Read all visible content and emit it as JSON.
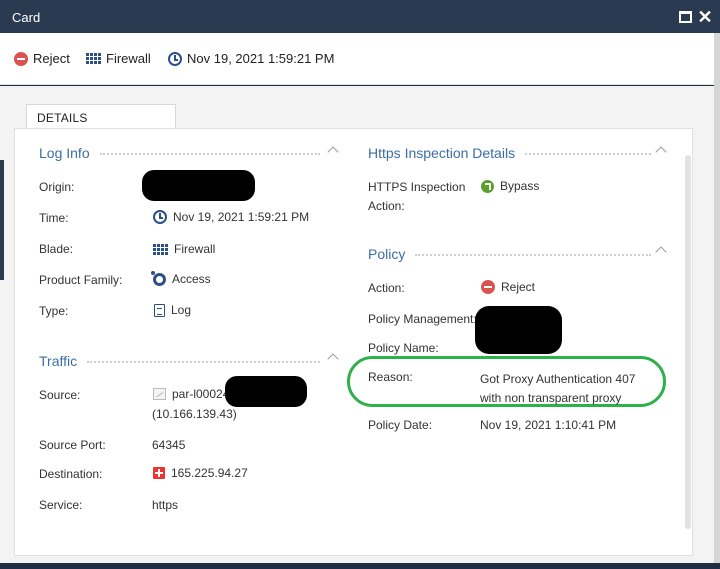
{
  "window": {
    "title": "Card"
  },
  "toolbar": {
    "action": "Reject",
    "blade": "Firewall",
    "time": "Nov 19, 2021 1:59:21 PM"
  },
  "tabs": [
    {
      "label": "DETAILS"
    }
  ],
  "log_info": {
    "title": "Log Info",
    "labels": {
      "origin": "Origin:",
      "time": "Time:",
      "blade": "Blade:",
      "product_family": "Product Family:",
      "type": "Type:"
    },
    "values": {
      "time": "Nov 19, 2021 1:59:21 PM",
      "blade": "Firewall",
      "product_family": "Access",
      "type": "Log"
    }
  },
  "traffic": {
    "title": "Traffic",
    "labels": {
      "source": "Source:",
      "source_port": "Source Port:",
      "destination": "Destination:",
      "service": "Service:"
    },
    "values": {
      "source_host": "par-l00024",
      "source_ip": "(10.166.139.43)",
      "source_port": "64345",
      "destination": "165.225.94.27",
      "service": "https"
    }
  },
  "https_inspection": {
    "title": "Https Inspection Details",
    "labels": {
      "action_line1": "HTTPS Inspection",
      "action_line2": "Action:"
    },
    "values": {
      "action": "Bypass"
    }
  },
  "policy": {
    "title": "Policy",
    "labels": {
      "action": "Action:",
      "management": "Policy Management:",
      "name": "Policy Name:",
      "reason": "Reason:",
      "date": "Policy Date:"
    },
    "values": {
      "action": "Reject",
      "reason": "Got Proxy Authentication 407 with non transparent proxy",
      "date": "Nov 19, 2021 1:10:41 PM"
    }
  },
  "colors": {
    "accent": "#3a6ea5",
    "titlebar": "#2a3a50",
    "reject": "#d9534f",
    "bypass": "#5aa02c",
    "highlight": "#2fb04a"
  }
}
